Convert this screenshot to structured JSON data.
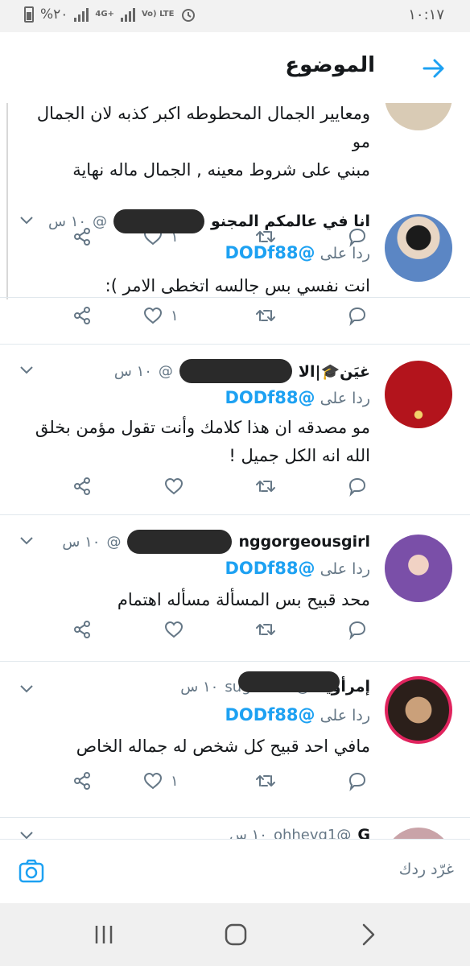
{
  "status_bar": {
    "battery_percent": "%٢٠",
    "network_1": "4G+",
    "network_2": "Vo) LTE",
    "time": "١٠:١٧"
  },
  "header": {
    "title": "الموضوع"
  },
  "tweets": [
    {
      "body_line1": "ومعايير الجمال المحطوطه اكبر كذبه لان الجمال مو",
      "body_line2": "مبني على شروط معينه , الجمال ماله نهاية",
      "like_count": "١"
    },
    {
      "name": "انا في عالمكم المجنو",
      "handle": "@",
      "time": "١٠ س",
      "reply_prefix": "ردا على",
      "reply_to": "@DODf88",
      "body": "انت نفسي بس جالسه اتخطى الامر ):",
      "like_count": "١"
    },
    {
      "name": "غيَن🎓|الا",
      "handle": "@",
      "time": "١٠ س",
      "reply_prefix": "ردا على",
      "reply_to": "@DODf88",
      "body_line1": "مو مصدقه ان هذا كلامك وأنت تقول مؤمن بخلق",
      "body_line2": "الله انه الكل جميل !",
      "like_count": ""
    },
    {
      "name": "nggorgeousgirl",
      "handle": "@",
      "time": "١٠ س",
      "reply_prefix": "ردا على",
      "reply_to": "@DODf88",
      "body": "محد قبيح بس المسألة مسأله اهتمام",
      "like_count": ""
    },
    {
      "name": "إمرأويه",
      "handle": "@sugarurra",
      "time": "١٠ س",
      "reply_prefix": "ردا على",
      "reply_to": "@DODf88",
      "body": "مافي احد قبيح كل شخص له جماله الخاص",
      "like_count": "١"
    },
    {
      "name": "G",
      "handle": "@ohhevg1",
      "time": "١٠ س"
    }
  ],
  "composer": {
    "placeholder": "غرّد ردك"
  },
  "colors": {
    "accent": "#1da1f2",
    "text": "#14171a",
    "secondary": "#657786",
    "divider": "#e1e8ed"
  },
  "icons": {
    "back": "arrow-right-icon",
    "reply": "reply-icon",
    "retweet": "retweet-icon",
    "like": "heart-icon",
    "share": "share-icon",
    "more": "chevron-down-icon",
    "camera": "camera-icon"
  }
}
